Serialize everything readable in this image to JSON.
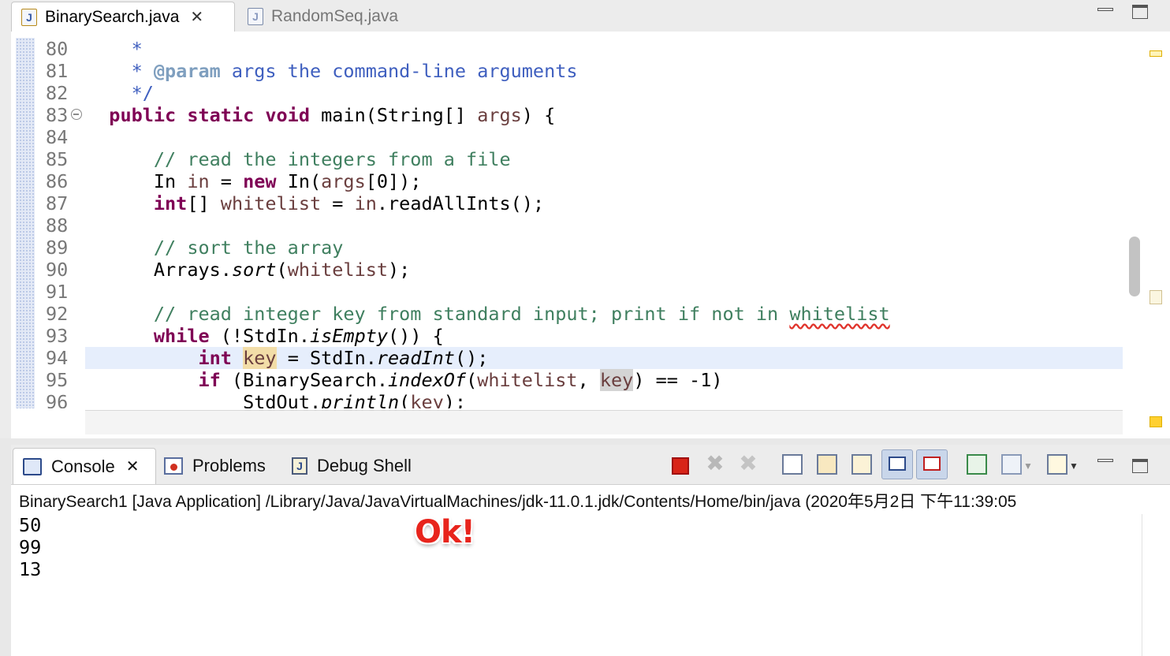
{
  "editor": {
    "tabs": [
      {
        "label": "BinarySearch.java",
        "icon": "java-file-icon",
        "active": true
      },
      {
        "label": "RandomSeq.java",
        "icon": "java-file-icon",
        "active": false
      }
    ],
    "lines": [
      {
        "num": "80",
        "indent": "    ",
        "tokens": [
          [
            "jd",
            "*"
          ]
        ]
      },
      {
        "num": "81",
        "indent": "    ",
        "tokens": [
          [
            "jd",
            "* "
          ],
          [
            "tag",
            "@param"
          ],
          [
            "jd",
            " args the command-line arguments"
          ]
        ]
      },
      {
        "num": "82",
        "indent": "    ",
        "tokens": [
          [
            "jd",
            "*/"
          ]
        ]
      },
      {
        "num": "83",
        "indent": "  ",
        "fold": true,
        "tokens": [
          [
            "kw",
            "public"
          ],
          [
            "pl",
            " "
          ],
          [
            "kw",
            "static"
          ],
          [
            "pl",
            " "
          ],
          [
            "kw",
            "void"
          ],
          [
            "pl",
            " main(String[] "
          ],
          [
            "var",
            "args"
          ],
          [
            "pl",
            ") {"
          ]
        ]
      },
      {
        "num": "84",
        "indent": "",
        "tokens": []
      },
      {
        "num": "85",
        "indent": "      ",
        "tokens": [
          [
            "cm",
            "// read the integers from a file"
          ]
        ]
      },
      {
        "num": "86",
        "indent": "      ",
        "tokens": [
          [
            "pl",
            "In "
          ],
          [
            "var",
            "in"
          ],
          [
            "pl",
            " = "
          ],
          [
            "kw",
            "new"
          ],
          [
            "pl",
            " In("
          ],
          [
            "var",
            "args"
          ],
          [
            "pl",
            "[0]);"
          ]
        ]
      },
      {
        "num": "87",
        "indent": "      ",
        "tokens": [
          [
            "kw",
            "int"
          ],
          [
            "pl",
            "[] "
          ],
          [
            "var",
            "whitelist"
          ],
          [
            "pl",
            " = "
          ],
          [
            "var",
            "in"
          ],
          [
            "pl",
            ".readAllInts();"
          ]
        ]
      },
      {
        "num": "88",
        "indent": "",
        "tokens": []
      },
      {
        "num": "89",
        "indent": "      ",
        "tokens": [
          [
            "cm",
            "// sort the array"
          ]
        ]
      },
      {
        "num": "90",
        "indent": "      ",
        "tokens": [
          [
            "pl",
            "Arrays."
          ],
          [
            "it",
            "sort"
          ],
          [
            "pl",
            "("
          ],
          [
            "var",
            "whitelist"
          ],
          [
            "pl",
            ");"
          ]
        ]
      },
      {
        "num": "91",
        "indent": "",
        "tokens": []
      },
      {
        "num": "92",
        "indent": "      ",
        "tokens": [
          [
            "cm",
            "// read integer key from standard input; print if not in "
          ],
          [
            "cmsq",
            "whitelist"
          ]
        ]
      },
      {
        "num": "93",
        "indent": "      ",
        "tokens": [
          [
            "kw",
            "while"
          ],
          [
            "pl",
            " (!StdIn."
          ],
          [
            "it",
            "isEmpty"
          ],
          [
            "pl",
            "()) {"
          ]
        ]
      },
      {
        "num": "94",
        "indent": "          ",
        "highlight": true,
        "tokens": [
          [
            "kw",
            "int"
          ],
          [
            "pl",
            " "
          ],
          [
            "occ",
            "key"
          ],
          [
            "pl",
            " = StdIn."
          ],
          [
            "it",
            "readInt"
          ],
          [
            "pl",
            "();"
          ]
        ]
      },
      {
        "num": "95",
        "indent": "          ",
        "tokens": [
          [
            "kw",
            "if"
          ],
          [
            "pl",
            " (BinarySearch."
          ],
          [
            "it",
            "indexOf"
          ],
          [
            "pl",
            "("
          ],
          [
            "var",
            "whitelist"
          ],
          [
            "pl",
            ", "
          ],
          [
            "occ2",
            "key"
          ],
          [
            "pl",
            ") == -1)"
          ]
        ]
      },
      {
        "num": "96",
        "indent": "              ",
        "tokens": [
          [
            "pl",
            "StdOut."
          ],
          [
            "it",
            "println"
          ],
          [
            "pl",
            "("
          ],
          [
            "var",
            "key"
          ],
          [
            "pl",
            ");"
          ]
        ]
      }
    ]
  },
  "console": {
    "tabs": [
      {
        "label": "Console",
        "icon": "console-icon",
        "active": true
      },
      {
        "label": "Problems",
        "icon": "problems-icon",
        "active": false
      },
      {
        "label": "Debug Shell",
        "icon": "debug-shell-icon",
        "active": false
      }
    ],
    "description": "BinarySearch1 [Java Application] /Library/Java/JavaVirtualMachines/jdk-11.0.1.jdk/Contents/Home/bin/java (2020年5月2日 下午11:39:05",
    "output": [
      "50",
      "99",
      "13"
    ],
    "annotation": "Ok!"
  },
  "colors": {
    "keyword": "#7f0055",
    "comment": "#3f7f5f",
    "javadoc": "#3f5fbf",
    "variable": "#6a3e3e",
    "current_line": "#e6eefc",
    "annotation": "#e8241c"
  }
}
